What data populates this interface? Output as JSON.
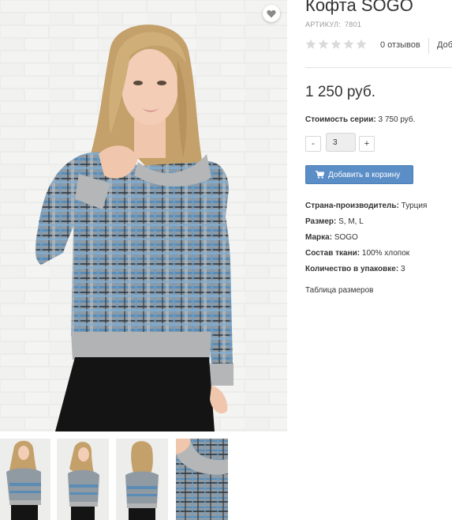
{
  "product": {
    "title": "Кофта SOGO",
    "article_label": "АРТИКУЛ:",
    "article_value": "7801",
    "rating": 0,
    "reviews_label": "0 отзывов",
    "add_review_label": "Доб",
    "price": "1 250 руб.",
    "series_cost_label": "Стоимость серии:",
    "series_cost_value": "3 750 руб.",
    "quantity": "3",
    "minus_label": "-",
    "plus_label": "+",
    "add_to_cart_label": "Добавить в корзину",
    "properties": [
      {
        "label": "Страна-производитель:",
        "value": "Турция"
      },
      {
        "label": "Размер:",
        "value": "S, M, L"
      },
      {
        "label": "Марка:",
        "value": "SOGO"
      },
      {
        "label": "Состав ткани:",
        "value": "100% хлопок"
      },
      {
        "label": "Количество в упаковке:",
        "value": "3"
      }
    ],
    "size_table_label": "Таблица размеров"
  },
  "gallery": {
    "thumbnails": [
      "front-view",
      "three-quarter-view",
      "back-view",
      "collar-detail"
    ]
  },
  "icons": {
    "favorite": "heart-icon",
    "cart": "cart-icon",
    "rating": "star-icon"
  },
  "colors": {
    "cart_button": "#5b8ec7",
    "star_empty": "#dadada",
    "text": "#333333",
    "muted": "#999999",
    "sweater_blue": "#5b8cb5",
    "sweater_grey": "#a9acae"
  }
}
